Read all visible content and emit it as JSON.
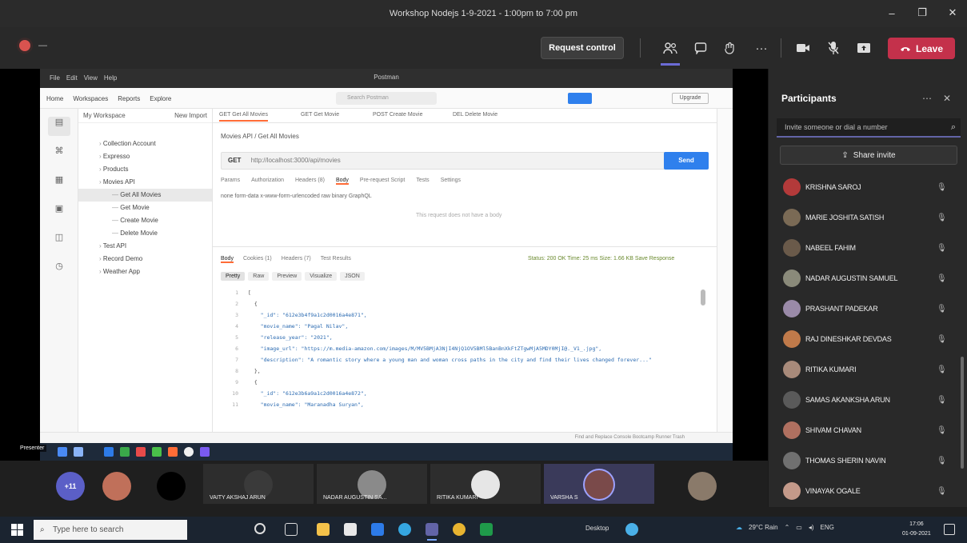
{
  "window": {
    "title": "Workshop Nodejs 1-9-2021 - 1:00pm to 7:00 pm",
    "controls": [
      "–",
      "❐",
      "✕"
    ]
  },
  "toolbar": {
    "timer": "—",
    "request_control": "Request control",
    "more": "···",
    "leave": "Leave",
    "leave_icon": "phone-icon"
  },
  "postman": {
    "window_title": "Postman",
    "menu": [
      "File",
      "Edit",
      "View",
      "Help"
    ],
    "nav": [
      "Home",
      "Workspaces",
      "Reports",
      "Explore"
    ],
    "search_placeholder": "Search Postman",
    "upgrade": "Upgrade",
    "sidebar": {
      "header": "My Workspace",
      "actions": "New  Import",
      "rail": [
        "Collections",
        "APIs",
        "Environments",
        "Mock Servers",
        "Monitors",
        "History"
      ],
      "tree": [
        {
          "label": "Collection Account",
          "indent": 1,
          "selected": false
        },
        {
          "label": "Expresso",
          "indent": 1,
          "selected": false
        },
        {
          "label": "Products",
          "indent": 1,
          "selected": false
        },
        {
          "label": "Movies API",
          "indent": 1,
          "selected": false
        },
        {
          "label": "Get All Movies",
          "indent": 2,
          "selected": true
        },
        {
          "label": "Get Movie",
          "indent": 2,
          "selected": false
        },
        {
          "label": "Create Movie",
          "indent": 2,
          "selected": false
        },
        {
          "label": "Delete Movie",
          "indent": 2,
          "selected": false
        },
        {
          "label": "Test API",
          "indent": 1,
          "selected": false
        },
        {
          "label": "Record Demo",
          "indent": 1,
          "selected": false
        },
        {
          "label": "Weather App",
          "indent": 1,
          "selected": false
        }
      ]
    },
    "tabs": [
      "GET Get All Movies",
      "GET Get Movie",
      "POST Create Movie",
      "DEL Delete Movie"
    ],
    "breadcrumb": "Movies API / Get All Movies",
    "method": "GET",
    "url": "http://localhost:3000/api/movies",
    "send": "Send",
    "request_tabs": [
      "Params",
      "Authorization",
      "Headers (8)",
      "Body",
      "Pre-request Script",
      "Tests",
      "Settings"
    ],
    "active_request_tab": "Body",
    "body_modes": "none   form-data   x-www-form-urlencoded   raw   binary   GraphQL",
    "body_empty": "This request does not have a body",
    "response_tabs": [
      "Body",
      "Cookies (1)",
      "Headers (7)",
      "Test Results"
    ],
    "status_line": "Status: 200 OK   Time: 25 ms   Size: 1.66 KB   Save Response",
    "format_buttons": [
      "Pretty",
      "Raw",
      "Preview",
      "Visualize",
      "JSON"
    ],
    "code_lines": [
      {
        "n": "1",
        "text": "["
      },
      {
        "n": "2",
        "text": "  {"
      },
      {
        "n": "3",
        "text": "    \"_id\": \"612e3b4f9a1c2d0016a4e871\","
      },
      {
        "n": "4",
        "text": "    \"movie_name\": \"Pagal Nilav\","
      },
      {
        "n": "5",
        "text": "    \"release_year\": \"2021\","
      },
      {
        "n": "6",
        "text": "    \"image_url\": \"https://m.media-amazon.com/images/M/MV5BMjA3NjI4NjQ1OV5BMl5BanBnXkFtZTgwMjA5MDY0MjI@._V1_.jpg\","
      },
      {
        "n": "7",
        "text": "    \"description\": \"A romantic story where a young man and woman cross paths in the city and find their lives changed forever...\""
      },
      {
        "n": "8",
        "text": "  },"
      },
      {
        "n": "9",
        "text": "  {"
      },
      {
        "n": "10",
        "text": "    \"_id\": \"612e3b6a9a1c2d0016a4e872\","
      },
      {
        "n": "11",
        "text": "    \"movie_name\": \"Maranadha Suryan\","
      }
    ],
    "footer": "Find and Replace   Console   Bootcamp   Runner   Trash"
  },
  "presenter_label": "Presenter",
  "panel": {
    "title": "Participants",
    "search_placeholder": "Invite someone or dial a number",
    "share_invite": "Share invite",
    "participants": [
      {
        "name": "KRISHNA SAROJ",
        "color": "#b33a3a"
      },
      {
        "name": "MARIE JOSHITA SATISH",
        "color": "#7a6a55"
      },
      {
        "name": "NABEEL FAHIM",
        "color": "#6a5a4a"
      },
      {
        "name": "NADAR AUGUSTIN SAMUEL",
        "color": "#8a8a7a"
      },
      {
        "name": "PRASHANT PADEKAR",
        "color": "#9a8aa8"
      },
      {
        "name": "RAJ DINESHKAR DEVDAS",
        "color": "#c07a4a"
      },
      {
        "name": "RITIKA KUMARI",
        "color": "#a88a7a"
      },
      {
        "name": "SAMAS AKANKSHA ARUN",
        "color": "#5a5a5a"
      },
      {
        "name": "SHIVAM CHAVAN",
        "color": "#b07060"
      },
      {
        "name": "THOMAS SHERIN NAVIN",
        "color": "#707070"
      },
      {
        "name": "VINAYAK OGALE",
        "color": "#c49a8a"
      }
    ]
  },
  "gallery": [
    {
      "name": "",
      "initials": "+11",
      "type": "bubble",
      "color": "#5b5fc7"
    },
    {
      "name": "",
      "type": "bubble",
      "color": "#c0705a"
    },
    {
      "name": "",
      "type": "bubble",
      "color": "#000000"
    },
    {
      "name": "VAITY AKSHAJ ARUN",
      "type": "tile",
      "color": "#3a3a3a"
    },
    {
      "name": "NADAR AUGUSTIN SA...",
      "type": "tile",
      "color": "#8a8a8a"
    },
    {
      "name": "RITIKA KUMARI",
      "type": "tile",
      "color": "#e6e6e6"
    },
    {
      "name": "VARSHA S",
      "type": "tile",
      "color": "#7a4a4a",
      "highlight": true
    },
    {
      "name": "",
      "type": "bubble",
      "color": "#8a7a6a"
    }
  ],
  "taskbar": {
    "search_placeholder": "Type here to search",
    "desktop": "Desktop",
    "weather": "29°C Rain",
    "lang": "ENG",
    "time": "17:06",
    "date": "01-09-2021"
  }
}
